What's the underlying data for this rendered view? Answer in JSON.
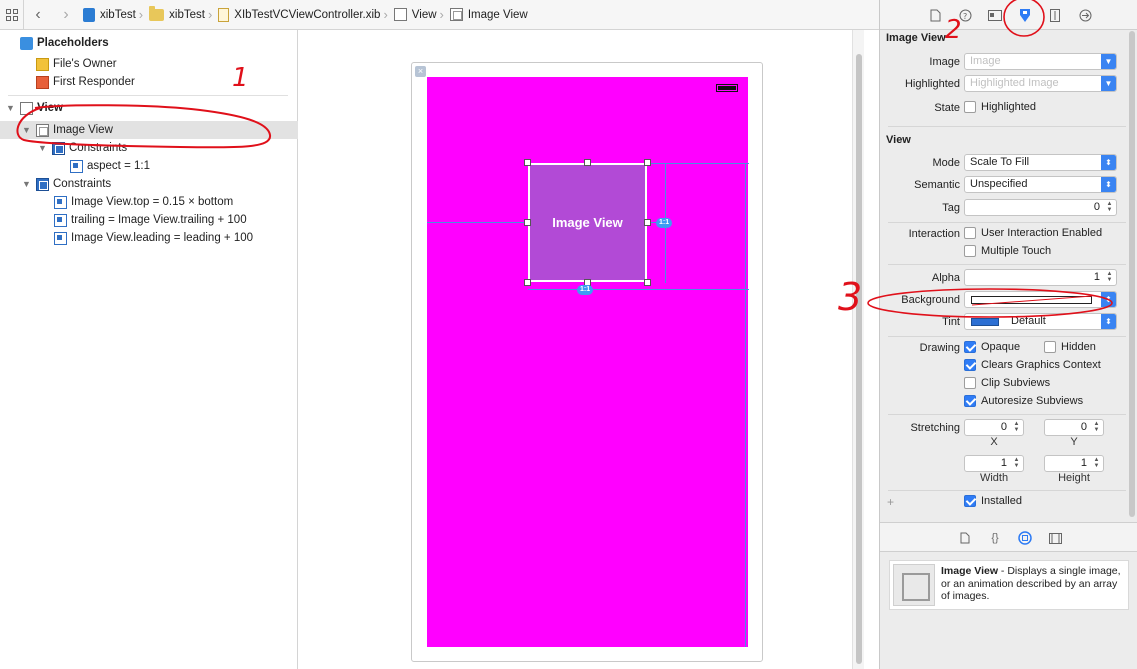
{
  "breadcrumb": {
    "items": [
      "xibTest",
      "xibTest",
      "XIbTestVCViewController.xib",
      "View",
      "Image View"
    ]
  },
  "outline": {
    "placeholders_label": "Placeholders",
    "files_owner": "File's Owner",
    "first_responder": "First Responder",
    "view": "View",
    "image_view": "Image View",
    "constraints_inner": "Constraints",
    "aspect": "aspect = 1:1",
    "constraints_outer": "Constraints",
    "constraint_items": [
      "Image View.top = 0.15 × bottom",
      "trailing = Image View.trailing + 100",
      "Image View.leading = leading + 100"
    ]
  },
  "canvas": {
    "image_view_label": "Image View",
    "badge_right": "1:1",
    "badge_bottom": "1:1"
  },
  "inspector": {
    "image_view_section": "Image View",
    "image_label": "Image",
    "image_placeholder": "Image",
    "highlighted_label": "Highlighted",
    "highlighted_placeholder": "Highlighted Image",
    "state_label": "State",
    "state_highlighted": "Highlighted",
    "view_section": "View",
    "mode_label": "Mode",
    "mode_value": "Scale To Fill",
    "semantic_label": "Semantic",
    "semantic_value": "Unspecified",
    "tag_label": "Tag",
    "tag_value": "0",
    "interaction_label": "Interaction",
    "user_interaction": "User Interaction Enabled",
    "multiple_touch": "Multiple Touch",
    "alpha_label": "Alpha",
    "alpha_value": "1",
    "background_label": "Background",
    "tint_label": "Tint",
    "tint_value": "Default",
    "drawing_label": "Drawing",
    "opaque": "Opaque",
    "hidden": "Hidden",
    "clears_graphics": "Clears Graphics Context",
    "clip_subviews": "Clip Subviews",
    "autoresize_subviews": "Autoresize Subviews",
    "stretching_label": "Stretching",
    "stretch_x": "0",
    "stretch_y": "0",
    "stretch_width": "1",
    "stretch_height": "1",
    "x_label": "X",
    "y_label": "Y",
    "width_label": "Width",
    "height_label": "Height",
    "installed": "Installed",
    "plus": "+"
  },
  "library": {
    "item_title": "Image View",
    "item_desc": " - Displays a single image, or an animation described by an array of images."
  },
  "annotations": {
    "one": "1",
    "two": "2",
    "three": "3"
  },
  "colors": {
    "canvas_background": "#ff00ff",
    "image_view_fill": "#b24ad6",
    "accent": "#2d7bf4",
    "annotation_red": "#e0101a"
  }
}
